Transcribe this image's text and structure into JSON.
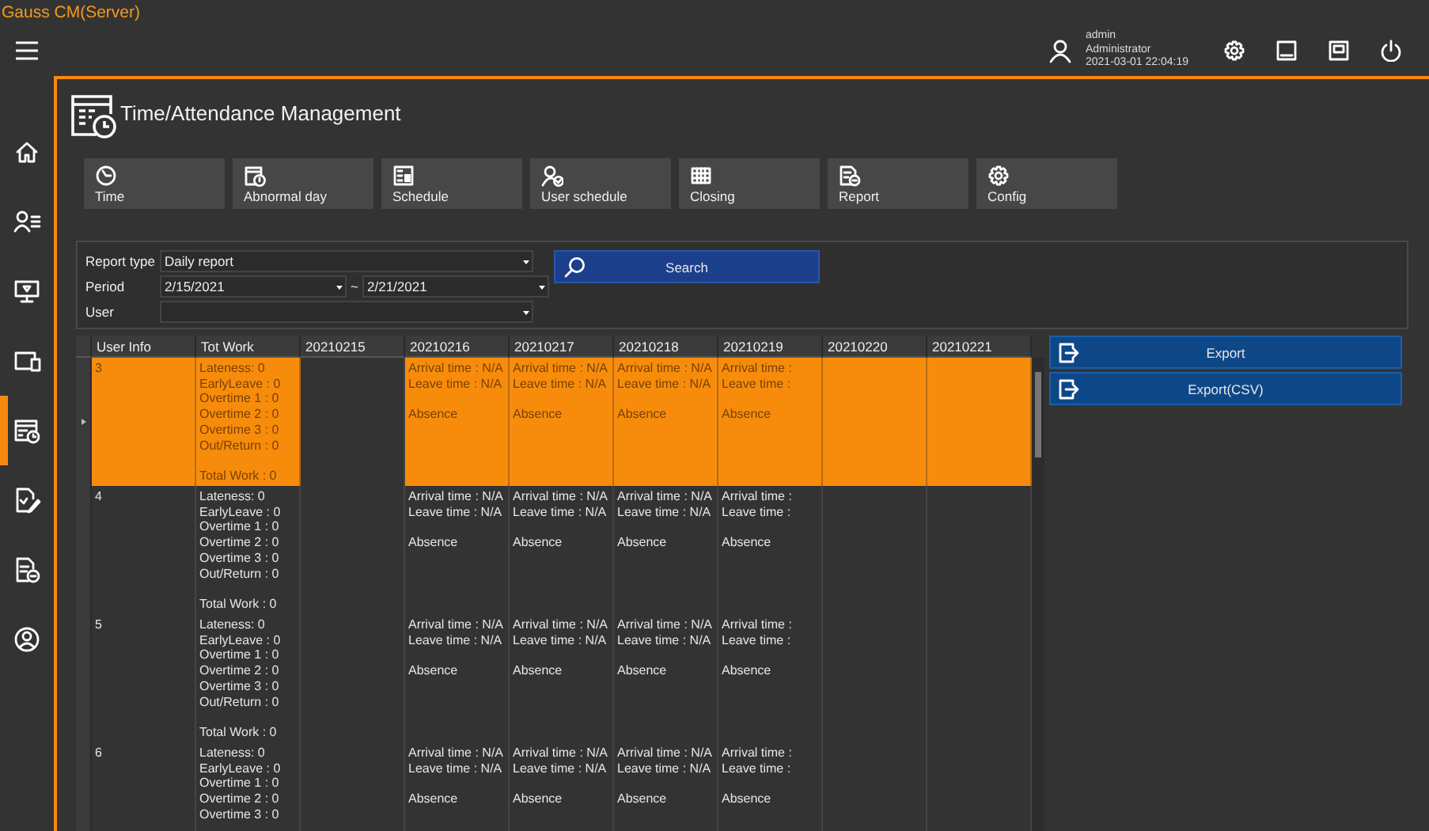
{
  "app_title": "Gauss CM(Server)",
  "header": {
    "user": {
      "name": "admin",
      "role": "Administrator",
      "datetime": "2021-03-01 22:04:19"
    }
  },
  "sidebar": {
    "items": [
      {
        "selected": false
      },
      {
        "selected": false
      },
      {
        "selected": false
      },
      {
        "selected": false
      },
      {
        "selected": true
      },
      {
        "selected": false
      },
      {
        "selected": false
      },
      {
        "selected": false
      }
    ]
  },
  "page": {
    "title": "Time/Attendance Management"
  },
  "toolbar": [
    "Time",
    "Abnormal day",
    "Schedule",
    "User schedule",
    "Closing",
    "Report",
    "Config"
  ],
  "filter": {
    "report_type": {
      "label": "Report type",
      "value": "Daily report"
    },
    "period": {
      "label": "Period",
      "from": "2/15/2021",
      "separator": "~",
      "to": "2/21/2021"
    },
    "user": {
      "label": "User"
    },
    "search_button": "Search"
  },
  "table": {
    "columns": [
      "User Info",
      "Tot Work",
      "20210215",
      "20210216",
      "20210217",
      "20210218",
      "20210219",
      "20210220",
      "20210221"
    ],
    "rows": [
      {
        "selected": true,
        "user_info": "3",
        "tot_work": [
          "Lateness: 0",
          "EarlyLeave : 0",
          "Overtime 1 : 0",
          "Overtime 2 : 0",
          "Overtime 3 : 0",
          "Out/Return : 0"
        ],
        "total": "Total Work : 0",
        "days": [
          {
            "kind": "current"
          },
          {
            "kind": "attendance",
            "arrival": "Arrival time : N/A",
            "leave": "Leave time : N/A",
            "status": "Absence"
          },
          {
            "kind": "attendance",
            "arrival": "Arrival time : N/A",
            "leave": "Leave time : N/A",
            "status": "Absence"
          },
          {
            "kind": "attendance",
            "arrival": "Arrival time : N/A",
            "leave": "Leave time : N/A",
            "status": "Absence"
          },
          {
            "kind": "attendance",
            "arrival": "Arrival time :",
            "leave": "Leave time :",
            "status": "Absence"
          },
          {
            "kind": "blank"
          },
          {
            "kind": "blank"
          }
        ]
      },
      {
        "selected": false,
        "user_info": "4",
        "tot_work": [
          "Lateness: 0",
          "EarlyLeave : 0",
          "Overtime 1 : 0",
          "Overtime 2 : 0",
          "Overtime 3 : 0",
          "Out/Return : 0"
        ],
        "total": "Total Work : 0",
        "days": [
          {
            "kind": "blank"
          },
          {
            "kind": "attendance",
            "arrival": "Arrival time : N/A",
            "leave": "Leave time : N/A",
            "status": "Absence"
          },
          {
            "kind": "attendance",
            "arrival": "Arrival time : N/A",
            "leave": "Leave time : N/A",
            "status": "Absence"
          },
          {
            "kind": "attendance",
            "arrival": "Arrival time : N/A",
            "leave": "Leave time : N/A",
            "status": "Absence"
          },
          {
            "kind": "attendance",
            "arrival": "Arrival time :",
            "leave": "Leave time :",
            "status": "Absence"
          },
          {
            "kind": "blank"
          },
          {
            "kind": "blank"
          }
        ]
      },
      {
        "selected": false,
        "user_info": "5",
        "tot_work": [
          "Lateness: 0",
          "EarlyLeave : 0",
          "Overtime 1 : 0",
          "Overtime 2 : 0",
          "Overtime 3 : 0",
          "Out/Return : 0"
        ],
        "total": "Total Work : 0",
        "days": [
          {
            "kind": "blank"
          },
          {
            "kind": "attendance",
            "arrival": "Arrival time : N/A",
            "leave": "Leave time : N/A",
            "status": "Absence"
          },
          {
            "kind": "attendance",
            "arrival": "Arrival time : N/A",
            "leave": "Leave time : N/A",
            "status": "Absence"
          },
          {
            "kind": "attendance",
            "arrival": "Arrival time : N/A",
            "leave": "Leave time : N/A",
            "status": "Absence"
          },
          {
            "kind": "attendance",
            "arrival": "Arrival time :",
            "leave": "Leave time :",
            "status": "Absence"
          },
          {
            "kind": "blank"
          },
          {
            "kind": "blank"
          }
        ]
      },
      {
        "selected": false,
        "user_info": "6",
        "tot_work": [
          "Lateness: 0",
          "EarlyLeave : 0",
          "Overtime 1 : 0",
          "Overtime 2 : 0",
          "Overtime 3 : 0"
        ],
        "days": [
          {
            "kind": "blank"
          },
          {
            "kind": "attendance",
            "arrival": "Arrival time : N/A",
            "leave": "Leave time : N/A",
            "status": "Absence"
          },
          {
            "kind": "attendance",
            "arrival": "Arrival time : N/A",
            "leave": "Leave time : N/A",
            "status": "Absence"
          },
          {
            "kind": "attendance",
            "arrival": "Arrival time : N/A",
            "leave": "Leave time : N/A",
            "status": "Absence"
          },
          {
            "kind": "attendance",
            "arrival": "Arrival time :",
            "leave": "Leave time :",
            "status": "Absence"
          },
          {
            "kind": "blank"
          },
          {
            "kind": "blank"
          }
        ]
      }
    ]
  },
  "actions": [
    "Export",
    "Export(CSV)"
  ]
}
